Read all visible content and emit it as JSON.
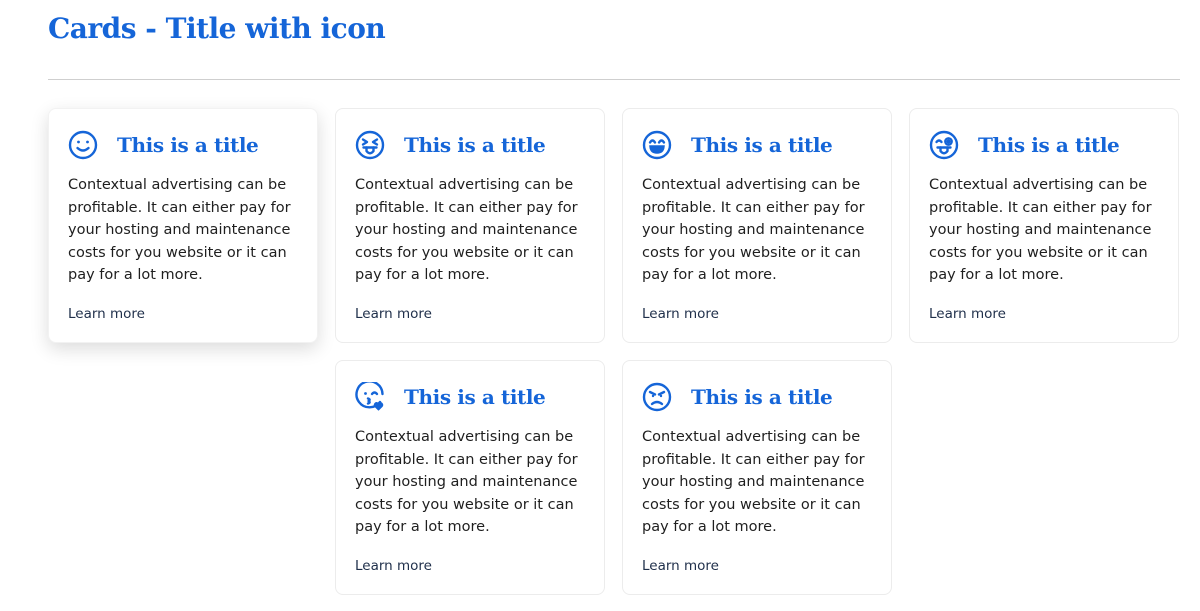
{
  "page": {
    "title": "Cards - Title with icon"
  },
  "theme": {
    "accent": "#1565d8",
    "text": "#1f1f1f",
    "link": "#1f2f4a"
  },
  "cards": [
    {
      "icon": "smile-icon",
      "title": "This is a title",
      "text": "Contextual advertising can be profitable. It can either pay for your hosting and maintenance costs for you website or it can pay for a lot more.",
      "link": "Learn more"
    },
    {
      "icon": "squint-tongue-icon",
      "title": "This is a title",
      "text": "Contextual advertising can be profitable. It can either pay for your hosting and maintenance costs for you website or it can pay for a lot more.",
      "link": "Learn more"
    },
    {
      "icon": "grin-beam-icon",
      "title": "This is a title",
      "text": "Contextual advertising can be profitable. It can either pay for your hosting and maintenance costs for you website or it can pay for a lot more.",
      "link": "Learn more"
    },
    {
      "icon": "wink-tongue-icon",
      "title": "This is a title",
      "text": "Contextual advertising can be profitable. It can either pay for your hosting and maintenance costs for you website or it can pay for a lot more.",
      "link": "Learn more"
    },
    {
      "icon": "kiss-wink-heart-icon",
      "title": "This is a title",
      "text": "Contextual advertising can be profitable. It can either pay for your hosting and maintenance costs for you website or it can pay for a lot more.",
      "link": "Learn more"
    },
    {
      "icon": "angry-icon",
      "title": "This is a title",
      "text": "Contextual advertising can be profitable. It can either pay for your hosting and maintenance costs for you website or it can pay for a lot more.",
      "link": "Learn more"
    }
  ]
}
